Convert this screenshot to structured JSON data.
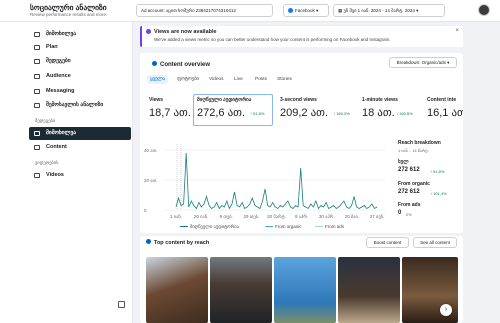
{
  "header": {
    "app_title": "სოციალური ანალიზი",
    "app_subtitle": "Review performance results and more.",
    "ad_account": "Ad account: აცით ხოშური 2384217074310412",
    "platform": "Facebook",
    "date_range": "უნ შვი 1 იან. 2024 - 14 მარტ. 2024"
  },
  "sidebar": {
    "items": [
      {
        "label": "მიმოხილვა"
      },
      {
        "label": "Plan"
      },
      {
        "label": "შედეგები"
      },
      {
        "label": "Audience"
      },
      {
        "label": "Messaging"
      },
      {
        "label": "შემოსავლის ანალიზი"
      }
    ],
    "section_results": "შედეგები",
    "results_items": [
      {
        "label": "მიმოხილვა"
      },
      {
        "label": "Content"
      }
    ],
    "section_content_types": "ვიდეოების",
    "content_types_items": [
      {
        "label": "Videos"
      }
    ]
  },
  "banner": {
    "title": "Views are now available",
    "description": "We've added a views metric so you can better understand how your content is performing on Facebook and Instagram."
  },
  "overview": {
    "title": "Content overview",
    "breakdown": "Breakdown: Organic/ads",
    "tabs": [
      "ყველა",
      "ფოტოები",
      "Videos",
      "Live",
      "Posts",
      "Stories"
    ],
    "metrics": [
      {
        "label": "Views",
        "value": "18,7 ათ.",
        "change": ""
      },
      {
        "label": "მიღწეული აუდიტორია",
        "value": "272,6 ათ.",
        "change": "↑ 51,8%"
      },
      {
        "label": "3-second views",
        "value": "209,2 ათ.",
        "change": "↑ 169,3%"
      },
      {
        "label": "1-minute views",
        "value": "18 ათ.",
        "change": "↑ 169,5%"
      },
      {
        "label": "Content inte",
        "value": "16,1 ათ.",
        "change": ""
      }
    ]
  },
  "reach_breakdown": {
    "title": "Reach breakdown",
    "date": "1 იან. - 14 მარტ.",
    "total_label": "სულ",
    "total_value": "272 612",
    "total_change": "↑ 51,8%",
    "organic_label": "From organic",
    "organic_value": "272 612",
    "organic_change": "↑ 101,4%",
    "ads_label": "From ads",
    "ads_value": "0",
    "ads_change": "0%"
  },
  "chart_data": {
    "type": "line",
    "ylim": [
      0,
      40
    ],
    "yticks": [
      "40 ათ.",
      "20 ათ.",
      "0"
    ],
    "xticks": [
      "1 იან.",
      "20 იან.",
      "9 თებ.",
      "29 თებ.",
      "20 მარტ.",
      "9 აპრ.",
      "30 აპრ.",
      "20 მაი.",
      "27 ივნ."
    ],
    "series": [
      {
        "name": "მიღწეული აუდიტორია",
        "values": [
          2,
          8,
          3,
          4,
          38,
          2,
          6,
          3,
          1,
          5,
          2,
          4,
          9,
          3,
          1,
          2,
          5,
          1,
          3,
          2,
          6,
          1,
          4,
          12,
          3,
          2,
          5,
          1,
          2,
          4,
          8,
          3,
          2,
          1,
          6,
          14,
          3,
          2,
          5,
          2,
          1,
          3,
          2,
          4,
          6,
          2,
          1,
          3,
          2,
          28,
          3,
          2,
          1,
          4,
          2,
          6,
          1,
          3,
          2,
          5,
          1,
          2,
          3,
          1,
          2,
          4,
          6,
          2,
          1,
          3,
          9,
          2,
          1,
          2,
          3,
          1,
          2,
          4,
          1,
          2
        ]
      },
      {
        "name": "From organic",
        "values": []
      },
      {
        "name": "From ads",
        "values": []
      }
    ]
  },
  "top_content": {
    "title": "Top content by reach",
    "boost_label": "Boost content",
    "see_all_label": "See all content"
  }
}
